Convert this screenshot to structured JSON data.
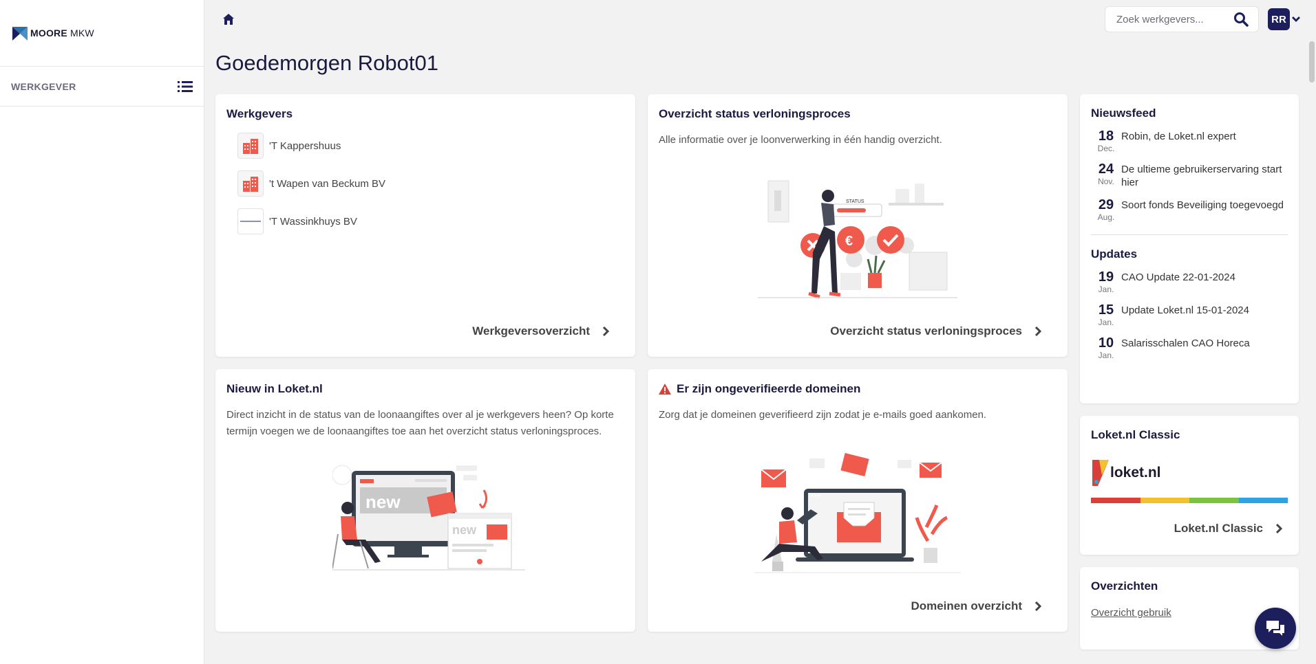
{
  "brand": {
    "name_bold": "MOORE",
    "name_rest": "MKW"
  },
  "sidebar": {
    "section_label": "WERKGEVER"
  },
  "search": {
    "placeholder": "Zoek werkgevers..."
  },
  "user": {
    "initials": "RR"
  },
  "greeting": "Goedemorgen Robot01",
  "werkgevers": {
    "title": "Werkgevers",
    "items": [
      "'T Kappershuus",
      "'t Wapen van Beckum BV",
      "'T Wassinkhuys BV"
    ],
    "link": "Werkgeversoverzicht"
  },
  "status": {
    "title": "Overzicht status verloningsproces",
    "text": "Alle informatie over je loonverwerking in één handig overzicht.",
    "illustration_label": "STATUS",
    "link": "Overzicht status verloningsproces"
  },
  "nieuw": {
    "title": "Nieuw in Loket.nl",
    "text": "Direct inzicht in de status van de loonaangiftes over al je werkgevers heen? Op korte termijn voegen we de loonaangiftes toe aan het overzicht status verloningsproces.",
    "illustration_word": "new"
  },
  "domeinen": {
    "title": "Er zijn ongeverifieerde domeinen",
    "text": "Zorg dat je domeinen geverifieerd zijn zodat je e-mails goed aankomen.",
    "link": "Domeinen overzicht"
  },
  "nieuwsfeed": {
    "title": "Nieuwsfeed",
    "items": [
      {
        "day": "18",
        "month": "Dec.",
        "text": "Robin, de Loket.nl expert"
      },
      {
        "day": "24",
        "month": "Nov.",
        "text": "De ultieme gebruikerservaring start hier"
      },
      {
        "day": "29",
        "month": "Aug.",
        "text": "Soort fonds Beveiliging toegevoegd"
      }
    ]
  },
  "updates": {
    "title": "Updates",
    "items": [
      {
        "day": "19",
        "month": "Jan.",
        "text": "CAO Update 22-01-2024"
      },
      {
        "day": "15",
        "month": "Jan.",
        "text": "Update Loket.nl 15-01-2024"
      },
      {
        "day": "10",
        "month": "Jan.",
        "text": "Salarisschalen CAO Horeca"
      }
    ]
  },
  "classic": {
    "title": "Loket.nl Classic",
    "logo_text": "loket.nl",
    "link": "Loket.nl Classic",
    "stripe_colors": [
      "#d9403a",
      "#f3c12f",
      "#7cc142",
      "#2ea3e0"
    ]
  },
  "overzichten": {
    "title": "Overzichten",
    "link": "Overzicht gebruik"
  },
  "colors": {
    "primary": "#1c1f5c",
    "accent": "#ef5a4c",
    "warning": "#d9403a"
  }
}
